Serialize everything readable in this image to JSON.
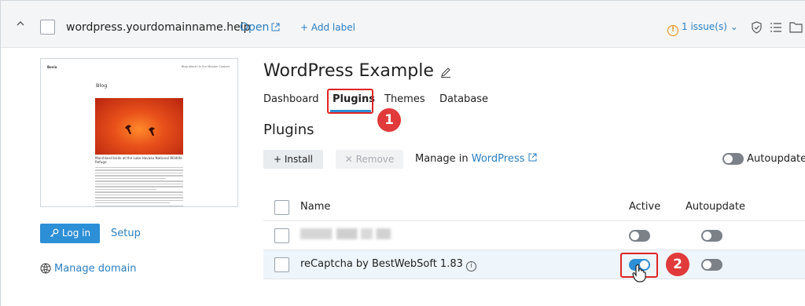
{
  "header": {
    "domain": "wordpress.yourdomainname.help",
    "open_label": "Open",
    "add_label": "+ Add label",
    "issues_label": "1 issue(s)"
  },
  "preview": {
    "site_name": "Bovia",
    "nav_text": "Blog  About Us  Our Mission  Contact",
    "blog_heading": "Blog",
    "post_caption": "Marshland birds at the Lake Havasu National Wildlife Refuge"
  },
  "left": {
    "login_label": "Log in",
    "setup_label": "Setup",
    "manage_domain_label": "Manage domain"
  },
  "main": {
    "title": "WordPress Example",
    "tabs": [
      {
        "label": "Dashboard",
        "active": false
      },
      {
        "label": "Plugins",
        "active": true
      },
      {
        "label": "Themes",
        "active": false
      },
      {
        "label": "Database",
        "active": false
      }
    ],
    "section_title": "Plugins",
    "install_label": "+ Install",
    "remove_label": "✕ Remove",
    "manage_in_text": "Manage in",
    "manage_in_link": "WordPress",
    "autoupdate_label": "Autoupdate",
    "autoupdate_on": false
  },
  "table": {
    "columns": [
      "Name",
      "Active",
      "Autoupdate"
    ],
    "rows": [
      {
        "name": "",
        "name_blurred": true,
        "active": false,
        "autoupdate": false
      },
      {
        "name": "reCaptcha by BestWebSoft 1.83",
        "name_blurred": false,
        "active": true,
        "autoupdate": false
      }
    ]
  },
  "annotations": {
    "step1": "1",
    "step2": "2",
    "highlight_color": "#e02424"
  },
  "colors": {
    "accent": "#2d8fd6",
    "link": "#2a7fc1",
    "warning": "#e38c10"
  }
}
